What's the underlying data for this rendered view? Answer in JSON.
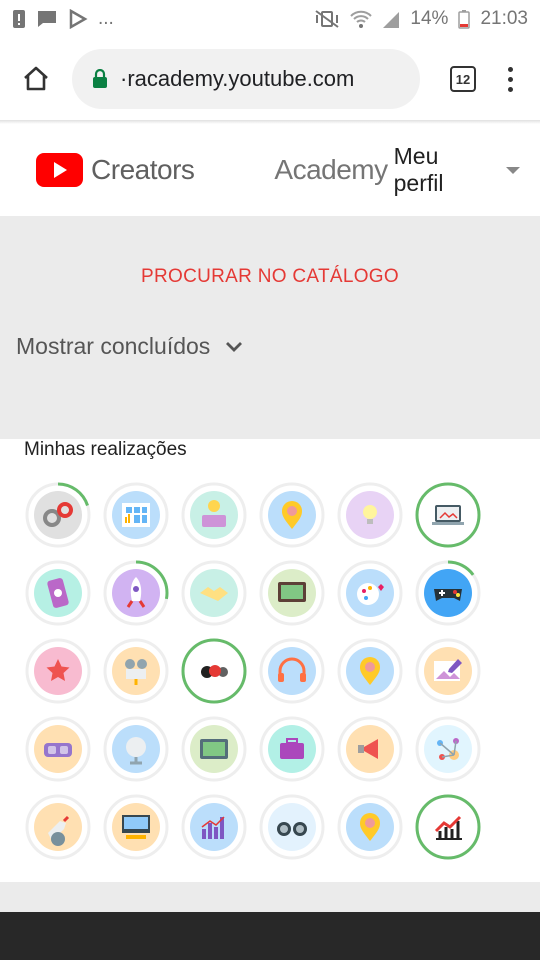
{
  "statusbar": {
    "dots": "...",
    "battery": "14%",
    "time": "21:03"
  },
  "browser": {
    "url": "·racademy.youtube.com",
    "tab_count": "12"
  },
  "header": {
    "brand": "Creators",
    "academy": "Academy",
    "profile": "Meu perfil"
  },
  "catalog": {
    "link": "PROCURAR NO CATÁLOGO"
  },
  "filter": {
    "label": "Mostrar concluídos"
  },
  "achievements": {
    "title": "Minhas realizações",
    "badges": [
      {
        "icon": "gears-icon",
        "color": "#e0e0e0",
        "progress": 0.2
      },
      {
        "icon": "grid-chart-icon",
        "color": "#bbdefb",
        "progress": 0
      },
      {
        "icon": "lightbulb-money-icon",
        "color": "#c8f0e6",
        "progress": 0
      },
      {
        "icon": "location-pin-icon",
        "color": "#bbdefb",
        "progress": 0
      },
      {
        "icon": "lightbulb-icon",
        "color": "#e8d3f5",
        "progress": 0
      },
      {
        "icon": "laptop-icon",
        "color": "#ffffff",
        "progress": 1
      },
      {
        "icon": "phone-icon",
        "color": "#b6f0e4",
        "progress": 0
      },
      {
        "icon": "rocket-icon",
        "color": "#d1b3f2",
        "progress": 0.28
      },
      {
        "icon": "handshake-icon",
        "color": "#c8f0e6",
        "progress": 0
      },
      {
        "icon": "monitor-icon",
        "color": "#dcedc8",
        "progress": 0
      },
      {
        "icon": "palette-heart-icon",
        "color": "#bbdefb",
        "progress": 0
      },
      {
        "icon": "gamepad-icon",
        "color": "#42a5f5",
        "progress": 0.15
      },
      {
        "icon": "star-icon",
        "color": "#f8bbd0",
        "progress": 0
      },
      {
        "icon": "camera-icon",
        "color": "#ffe0b2",
        "progress": 0
      },
      {
        "icon": "video-reels-icon",
        "color": "#ffffff",
        "progress": 1
      },
      {
        "icon": "headphones-icon",
        "color": "#bbdefb",
        "progress": 0
      },
      {
        "icon": "location-pin-icon",
        "color": "#bbdefb",
        "progress": 0
      },
      {
        "icon": "photo-edit-icon",
        "color": "#ffe0b2",
        "progress": 0
      },
      {
        "icon": "vr-headset-icon",
        "color": "#ffe0b2",
        "progress": 0
      },
      {
        "icon": "globe-icon",
        "color": "#bbdefb",
        "progress": 0
      },
      {
        "icon": "tv-icon",
        "color": "#dcedc8",
        "progress": 0
      },
      {
        "icon": "briefcase-icon",
        "color": "#b2f0e6",
        "progress": 0
      },
      {
        "icon": "megaphone-icon",
        "color": "#ffe0b2",
        "progress": 0
      },
      {
        "icon": "network-icon",
        "color": "#e1f5fe",
        "progress": 0
      },
      {
        "icon": "rocket-earth-icon",
        "color": "#ffe0b2",
        "progress": 0
      },
      {
        "icon": "video-editor-icon",
        "color": "#ffe0b2",
        "progress": 0
      },
      {
        "icon": "bar-chart-icon",
        "color": "#bbdefb",
        "progress": 0
      },
      {
        "icon": "binoculars-icon",
        "color": "#e3f2fd",
        "progress": 0
      },
      {
        "icon": "location-pin-icon",
        "color": "#bbdefb",
        "progress": 0
      },
      {
        "icon": "growth-chart-icon",
        "color": "#ffffff",
        "progress": 1
      }
    ]
  },
  "colors": {
    "accent_red": "#e53935",
    "progress_green": "#66bb6a",
    "youtube_red": "#ff0000"
  }
}
